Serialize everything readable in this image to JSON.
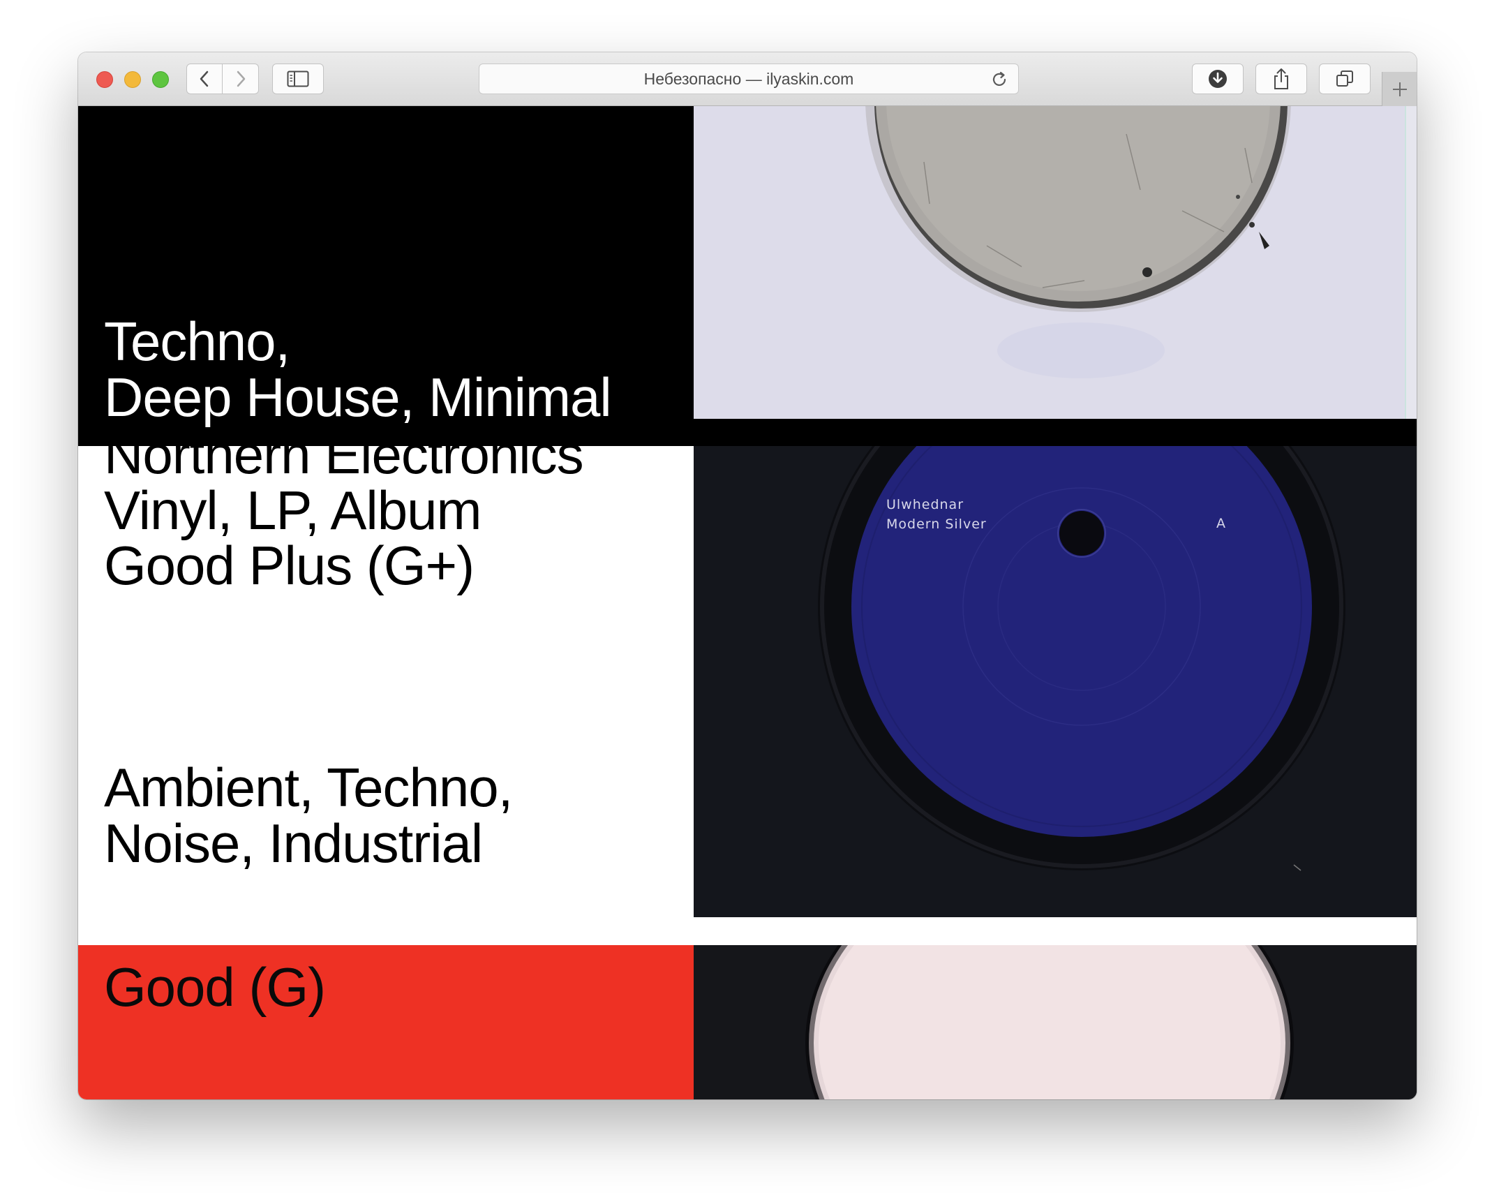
{
  "browser": {
    "address": "Небезопасно — ilyaskin.com",
    "icons": {
      "back": "chevron-left-icon",
      "forward": "chevron-right-icon",
      "sidebar": "sidebar-icon",
      "reload": "reload-icon",
      "download": "download-icon",
      "share": "share-icon",
      "tabs": "tabs-icon",
      "new_tab": "plus-icon"
    }
  },
  "records": [
    {
      "genre_lines": [
        "Techno,",
        "Deep House, Minimal"
      ],
      "panel_color": "#000000",
      "text_color": "#ffffff"
    },
    {
      "label": "Northern Electronics",
      "format": "Vinyl, LP, Album",
      "condition": "Good Plus (G+)",
      "genre_lines": [
        "Ambient, Techno,",
        "Noise, Industrial"
      ],
      "panel_color": "#ffffff",
      "text_color": "#000000",
      "vinyl_label": {
        "artist": "Ulwhednar",
        "title": "Modern Silver",
        "side": "A",
        "color": "#23237a"
      }
    },
    {
      "condition": "Good (G)",
      "panel_color": "#ee3124",
      "text_color": "#000000"
    }
  ]
}
